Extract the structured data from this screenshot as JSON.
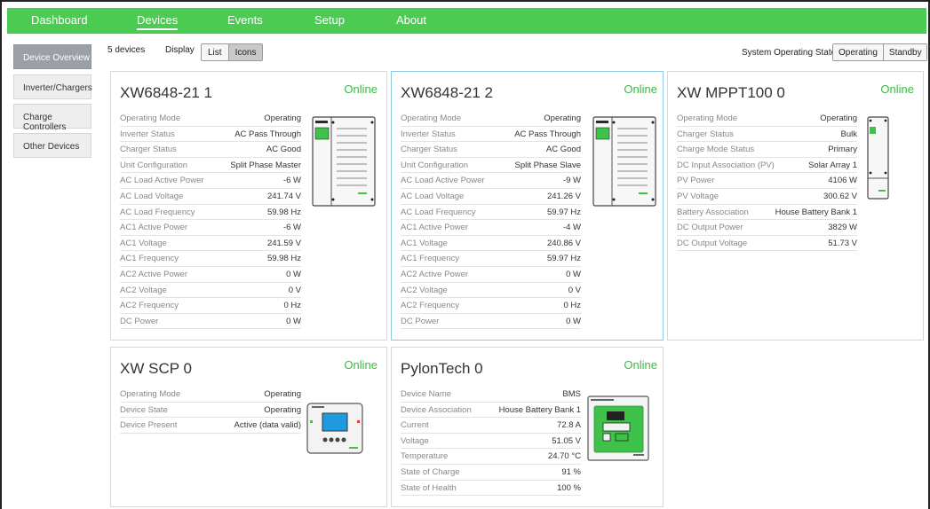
{
  "nav": {
    "items": [
      {
        "label": "Dashboard"
      },
      {
        "label": "Devices"
      },
      {
        "label": "Events"
      },
      {
        "label": "Setup"
      },
      {
        "label": "About"
      }
    ],
    "active": "Devices"
  },
  "sidebar": {
    "items": [
      {
        "label": "Device Overview"
      },
      {
        "label": "Inverter/Chargers"
      },
      {
        "label": "Charge Controllers"
      },
      {
        "label": "Other Devices"
      }
    ],
    "active": "Device Overview"
  },
  "toolbar": {
    "device_count": "5 devices",
    "display_label": "Display",
    "display_options": {
      "list": "List",
      "icons": "Icons"
    },
    "display_selected": "Icons",
    "system_state_label": "System Operating State",
    "state_options": {
      "operating": "Operating",
      "standby": "Standby"
    }
  },
  "cards": [
    {
      "title": "XW6848-21 1",
      "status": "Online",
      "rows": [
        {
          "label": "Operating Mode",
          "value": "Operating"
        },
        {
          "label": "Inverter Status",
          "value": "AC Pass Through"
        },
        {
          "label": "Charger Status",
          "value": "AC Good"
        },
        {
          "label": "Unit Configuration",
          "value": "Split Phase Master"
        },
        {
          "label": "AC Load Active Power",
          "value": "-6 W"
        },
        {
          "label": "AC Load Voltage",
          "value": "241.74 V"
        },
        {
          "label": "AC Load Frequency",
          "value": "59.98 Hz"
        },
        {
          "label": "AC1 Active Power",
          "value": "-6 W"
        },
        {
          "label": "AC1 Voltage",
          "value": "241.59 V"
        },
        {
          "label": "AC1 Frequency",
          "value": "59.98 Hz"
        },
        {
          "label": "AC2 Active Power",
          "value": "0 W"
        },
        {
          "label": "AC2 Voltage",
          "value": "0 V"
        },
        {
          "label": "AC2 Frequency",
          "value": "0 Hz"
        },
        {
          "label": "DC Power",
          "value": "0 W"
        }
      ]
    },
    {
      "title": "XW6848-21 2",
      "status": "Online",
      "rows": [
        {
          "label": "Operating Mode",
          "value": "Operating"
        },
        {
          "label": "Inverter Status",
          "value": "AC Pass Through"
        },
        {
          "label": "Charger Status",
          "value": "AC Good"
        },
        {
          "label": "Unit Configuration",
          "value": "Split Phase Slave"
        },
        {
          "label": "AC Load Active Power",
          "value": "-9 W"
        },
        {
          "label": "AC Load Voltage",
          "value": "241.26 V"
        },
        {
          "label": "AC Load Frequency",
          "value": "59.97 Hz"
        },
        {
          "label": "AC1 Active Power",
          "value": "-4 W"
        },
        {
          "label": "AC1 Voltage",
          "value": "240.86 V"
        },
        {
          "label": "AC1 Frequency",
          "value": "59.97 Hz"
        },
        {
          "label": "AC2 Active Power",
          "value": "0 W"
        },
        {
          "label": "AC2 Voltage",
          "value": "0 V"
        },
        {
          "label": "AC2 Frequency",
          "value": "0 Hz"
        },
        {
          "label": "DC Power",
          "value": "0 W"
        }
      ]
    },
    {
      "title": "XW MPPT100 0",
      "status": "Online",
      "rows": [
        {
          "label": "Operating Mode",
          "value": "Operating"
        },
        {
          "label": "Charger Status",
          "value": "Bulk"
        },
        {
          "label": "Charge Mode Status",
          "value": "Primary"
        },
        {
          "label": "DC Input Association (PV)",
          "value": "Solar Array 1"
        },
        {
          "label": "PV Power",
          "value": "4106 W"
        },
        {
          "label": "PV Voltage",
          "value": "300.62 V"
        },
        {
          "label": "Battery Association",
          "value": "House Battery Bank 1"
        },
        {
          "label": "DC Output Power",
          "value": "3829 W"
        },
        {
          "label": "DC Output Voltage",
          "value": "51.73 V"
        }
      ]
    },
    {
      "title": "XW SCP 0",
      "status": "Online",
      "rows": [
        {
          "label": "Operating Mode",
          "value": "Operating"
        },
        {
          "label": "Device State",
          "value": "Operating"
        },
        {
          "label": "Device Present",
          "value": "Active (data valid)"
        }
      ]
    },
    {
      "title": "PylonTech 0",
      "status": "Online",
      "rows": [
        {
          "label": "Device Name",
          "value": "BMS"
        },
        {
          "label": "Device Association",
          "value": "House Battery Bank 1"
        },
        {
          "label": "Current",
          "value": "72.8 A"
        },
        {
          "label": "Voltage",
          "value": "51.05 V"
        },
        {
          "label": "Temperature",
          "value": "24.70 °C"
        },
        {
          "label": "State of Charge",
          "value": "91 %"
        },
        {
          "label": "State of Health",
          "value": "100 %"
        }
      ]
    }
  ],
  "colors": {
    "brand_green": "#4ccb52",
    "online_green": "#3cb944",
    "highlight_border": "#8cc7e6",
    "sidebar_active": "#9aa0a6"
  },
  "icons": {
    "inverter": "inverter-device-icon",
    "mppt": "mppt-device-icon",
    "scp": "scp-panel-icon",
    "bms": "battery-monitor-icon"
  }
}
